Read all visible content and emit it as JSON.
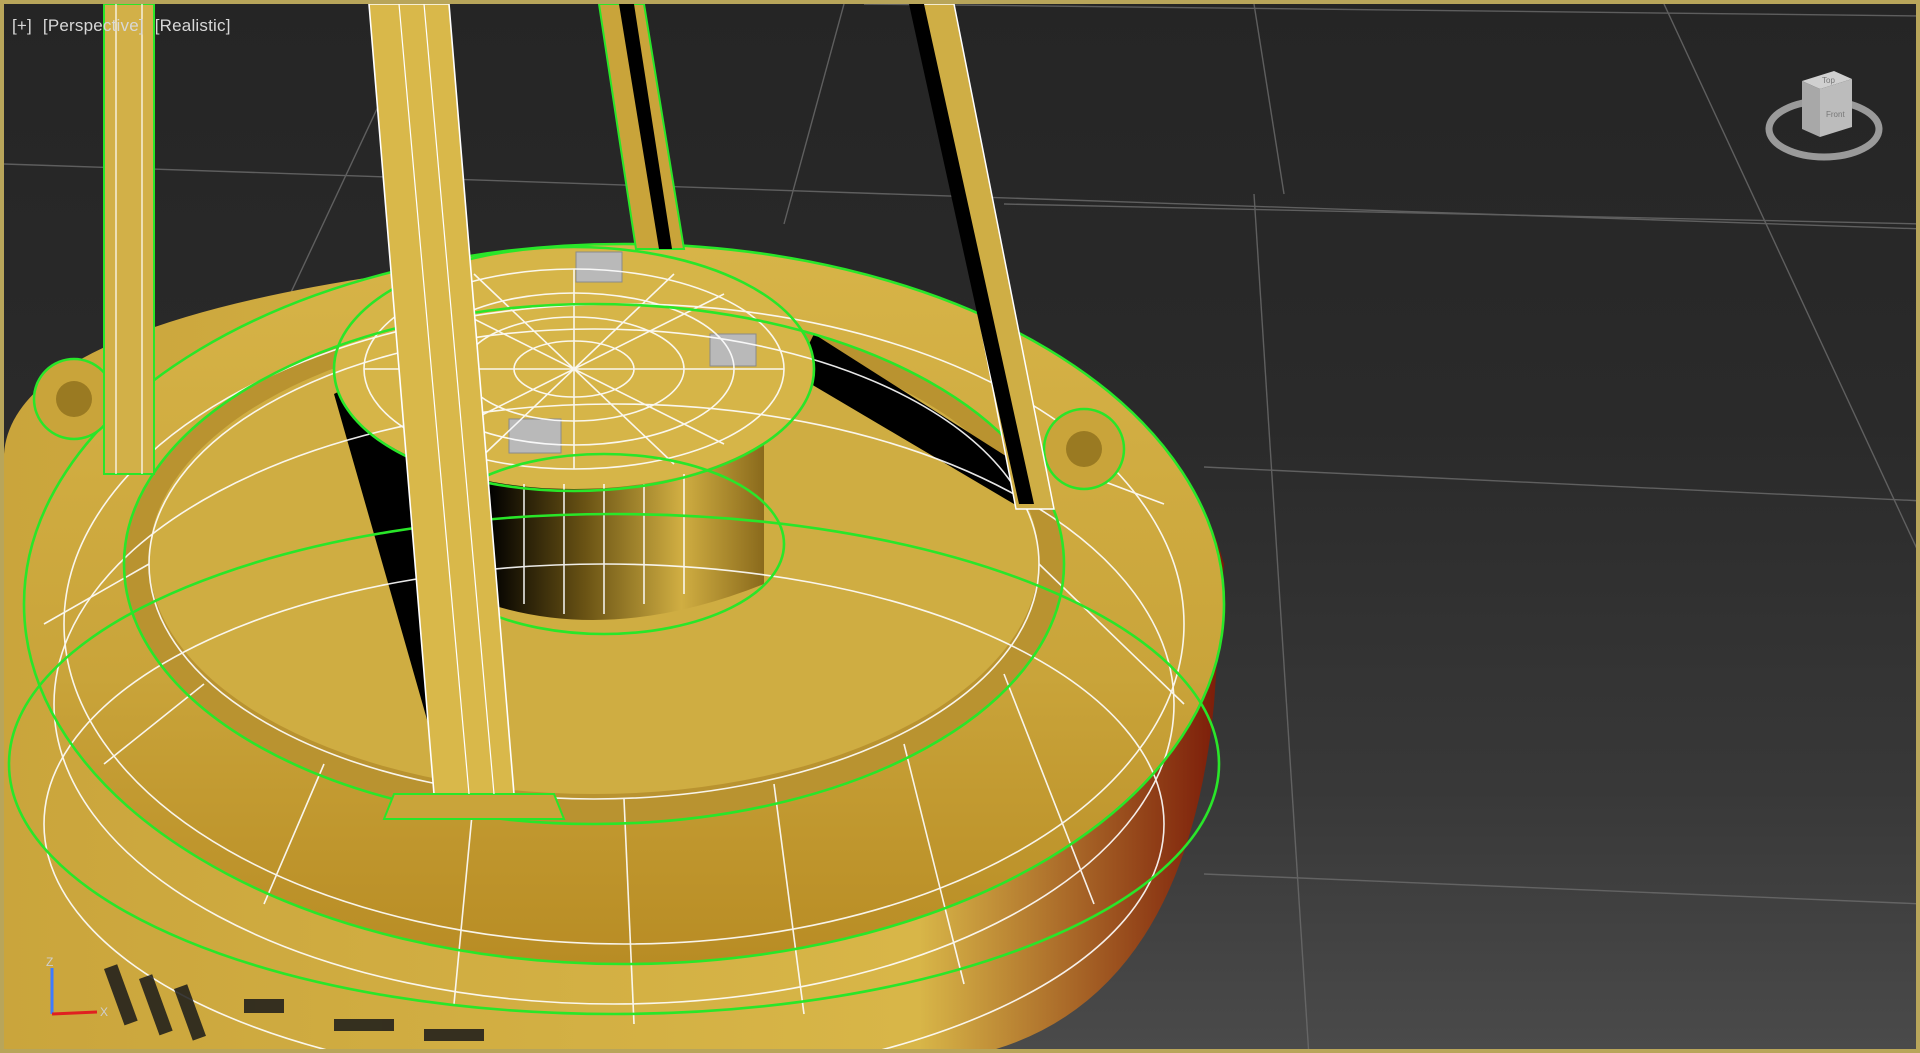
{
  "viewport": {
    "labels": {
      "plus": "[+]",
      "view": "[Perspective]",
      "shading": "[Realistic]"
    },
    "viewcube": {
      "top_face": "Top",
      "front_face": "Front"
    },
    "axis": {
      "z": "Z",
      "x": "X"
    },
    "colors": {
      "frame": "#b8a55a",
      "model": "#c9a43a",
      "wire_white": "#ffffff",
      "wire_green": "#29e629",
      "grid": "#6d6d6d",
      "background": "#2a2a2a"
    }
  }
}
